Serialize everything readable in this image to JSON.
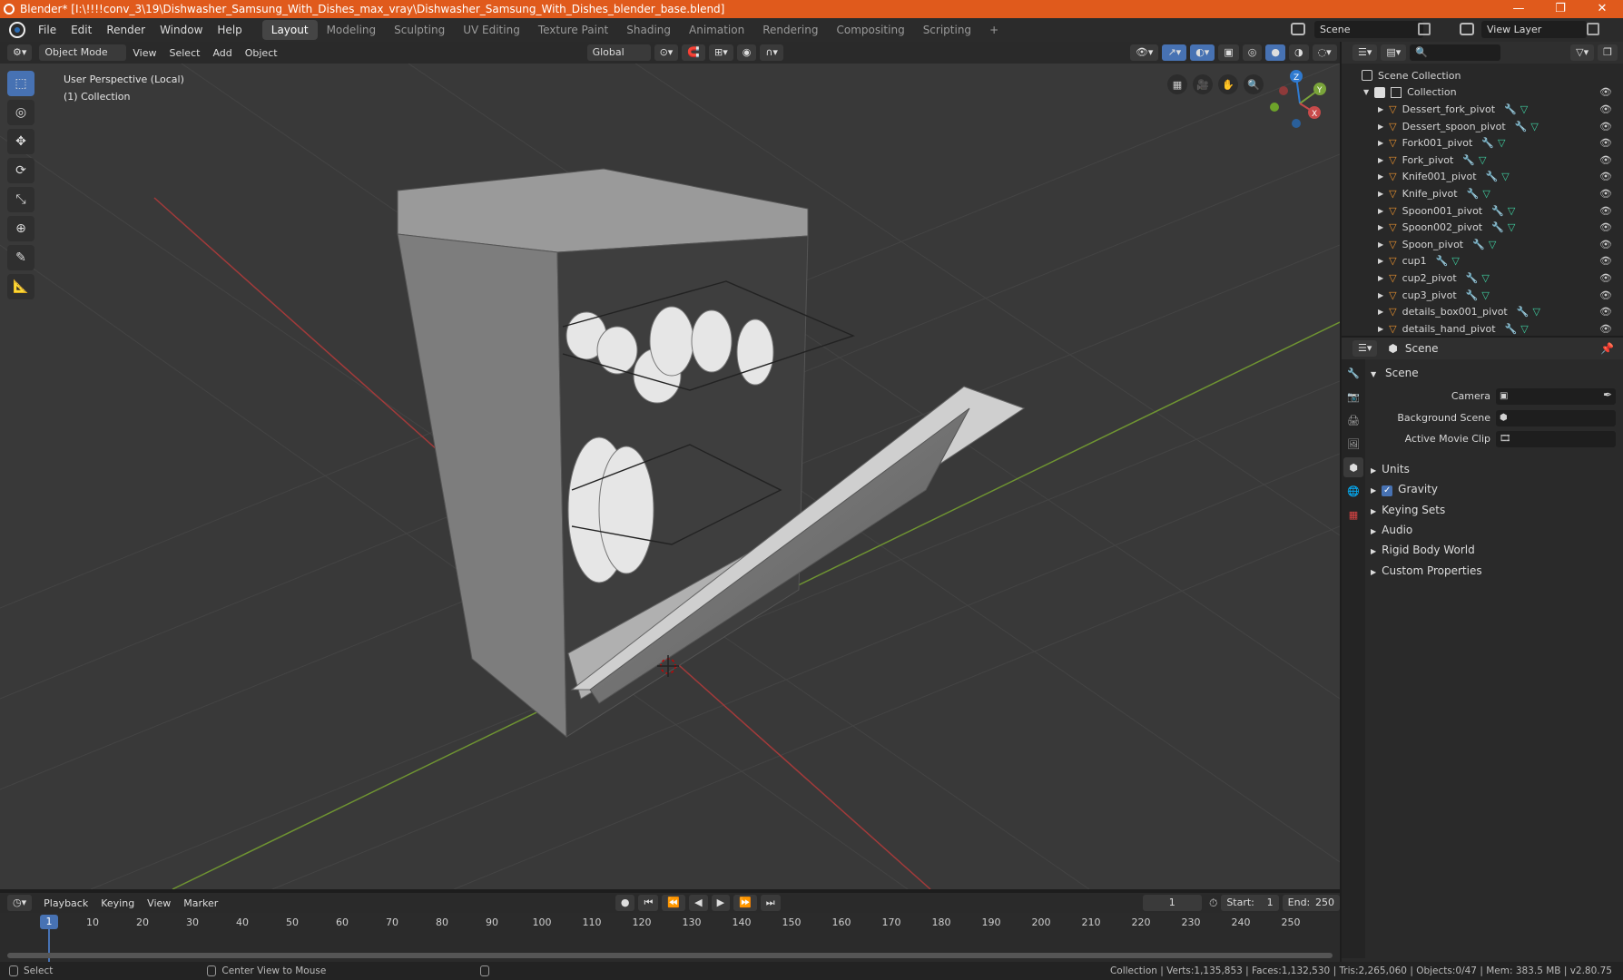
{
  "window": {
    "title": "Blender* [I:\\!!!!conv_3\\19\\Dishwasher_Samsung_With_Dishes_max_vray\\Dishwasher_Samsung_With_Dishes_blender_base.blend]",
    "controls": [
      "—",
      "❐",
      "✕"
    ]
  },
  "menu": {
    "items": [
      "File",
      "Edit",
      "Render",
      "Window",
      "Help"
    ],
    "workspaces": [
      "Layout",
      "Modeling",
      "Sculpting",
      "UV Editing",
      "Texture Paint",
      "Shading",
      "Animation",
      "Rendering",
      "Compositing",
      "Scripting"
    ],
    "active_workspace": "Layout",
    "add_tab": "+",
    "scene": "Scene",
    "view_layer": "View Layer"
  },
  "viewport_header": {
    "mode": "Object Mode",
    "menus": [
      "View",
      "Select",
      "Add",
      "Object"
    ],
    "transform_orientation": "Global"
  },
  "viewport": {
    "perspective": "User Perspective (Local)",
    "collection": "(1) Collection",
    "gizmo": {
      "x": "X",
      "y": "Y",
      "z": "Z"
    }
  },
  "outliner": {
    "root": "Scene Collection",
    "collection": "Collection",
    "objects": [
      "Dessert_fork_pivot",
      "Dessert_spoon_pivot",
      "Fork001_pivot",
      "Fork_pivot",
      "Knife001_pivot",
      "Knife_pivot",
      "Spoon001_pivot",
      "Spoon002_pivot",
      "Spoon_pivot",
      "cup1",
      "cup2_pivot",
      "cup3_pivot",
      "details_box001_pivot",
      "details_hand_pivot"
    ]
  },
  "properties": {
    "context": "Scene",
    "panel": "Scene",
    "fields": {
      "camera": "Camera",
      "background_scene": "Background Scene",
      "active_movie_clip": "Active Movie Clip"
    },
    "sections": [
      "Units",
      "Gravity",
      "Keying Sets",
      "Audio",
      "Rigid Body World",
      "Custom Properties"
    ],
    "gravity_checked": true
  },
  "timeline": {
    "menus": [
      "Playback",
      "Keying",
      "View",
      "Marker"
    ],
    "current_frame": "1",
    "start_label": "Start:",
    "start": "1",
    "end_label": "End:",
    "end": "250",
    "ruler": [
      "10",
      "20",
      "30",
      "40",
      "50",
      "60",
      "70",
      "80",
      "90",
      "100",
      "110",
      "120",
      "130",
      "140",
      "150",
      "160",
      "170",
      "180",
      "190",
      "200",
      "210",
      "220",
      "230",
      "240",
      "250"
    ]
  },
  "statusbar": {
    "select": "Select",
    "center": "Center View to Mouse",
    "stats": "Collection | Verts:1,135,853 | Faces:1,132,530 | Tris:2,265,060 | Objects:0/47 | Mem: 383.5 MB | v2.80.75"
  },
  "colors": {
    "accent": "#4772b3",
    "title_bar": "#e05a1c",
    "axis_x": "#c84a4a",
    "axis_y": "#7aa43a",
    "modifier_icon": "#5aa0e6",
    "mesh_icon": "#3fd1a2",
    "object_icon": "#e8912e"
  }
}
